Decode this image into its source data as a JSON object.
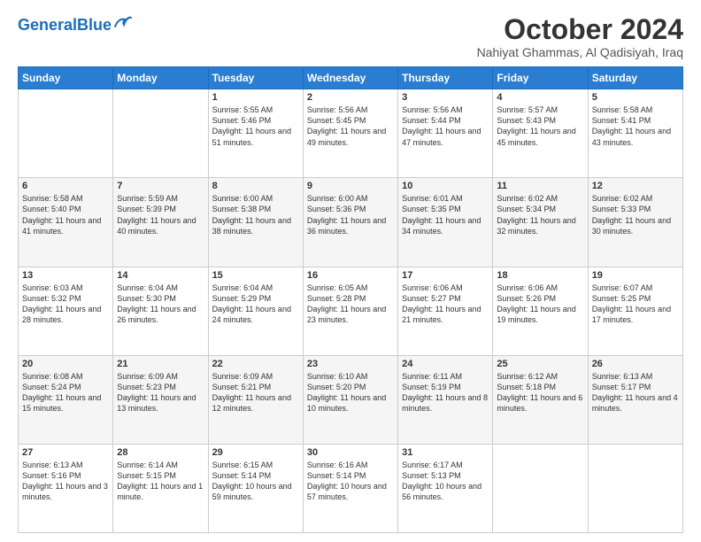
{
  "header": {
    "logo_general": "General",
    "logo_blue": "Blue",
    "month_title": "October 2024",
    "subtitle": "Nahiyat Ghammas, Al Qadisiyah, Iraq"
  },
  "days_of_week": [
    "Sunday",
    "Monday",
    "Tuesday",
    "Wednesday",
    "Thursday",
    "Friday",
    "Saturday"
  ],
  "weeks": [
    [
      {
        "day": "",
        "sunrise": "",
        "sunset": "",
        "daylight": ""
      },
      {
        "day": "",
        "sunrise": "",
        "sunset": "",
        "daylight": ""
      },
      {
        "day": "1",
        "sunrise": "Sunrise: 5:55 AM",
        "sunset": "Sunset: 5:46 PM",
        "daylight": "Daylight: 11 hours and 51 minutes."
      },
      {
        "day": "2",
        "sunrise": "Sunrise: 5:56 AM",
        "sunset": "Sunset: 5:45 PM",
        "daylight": "Daylight: 11 hours and 49 minutes."
      },
      {
        "day": "3",
        "sunrise": "Sunrise: 5:56 AM",
        "sunset": "Sunset: 5:44 PM",
        "daylight": "Daylight: 11 hours and 47 minutes."
      },
      {
        "day": "4",
        "sunrise": "Sunrise: 5:57 AM",
        "sunset": "Sunset: 5:43 PM",
        "daylight": "Daylight: 11 hours and 45 minutes."
      },
      {
        "day": "5",
        "sunrise": "Sunrise: 5:58 AM",
        "sunset": "Sunset: 5:41 PM",
        "daylight": "Daylight: 11 hours and 43 minutes."
      }
    ],
    [
      {
        "day": "6",
        "sunrise": "Sunrise: 5:58 AM",
        "sunset": "Sunset: 5:40 PM",
        "daylight": "Daylight: 11 hours and 41 minutes."
      },
      {
        "day": "7",
        "sunrise": "Sunrise: 5:59 AM",
        "sunset": "Sunset: 5:39 PM",
        "daylight": "Daylight: 11 hours and 40 minutes."
      },
      {
        "day": "8",
        "sunrise": "Sunrise: 6:00 AM",
        "sunset": "Sunset: 5:38 PM",
        "daylight": "Daylight: 11 hours and 38 minutes."
      },
      {
        "day": "9",
        "sunrise": "Sunrise: 6:00 AM",
        "sunset": "Sunset: 5:36 PM",
        "daylight": "Daylight: 11 hours and 36 minutes."
      },
      {
        "day": "10",
        "sunrise": "Sunrise: 6:01 AM",
        "sunset": "Sunset: 5:35 PM",
        "daylight": "Daylight: 11 hours and 34 minutes."
      },
      {
        "day": "11",
        "sunrise": "Sunrise: 6:02 AM",
        "sunset": "Sunset: 5:34 PM",
        "daylight": "Daylight: 11 hours and 32 minutes."
      },
      {
        "day": "12",
        "sunrise": "Sunrise: 6:02 AM",
        "sunset": "Sunset: 5:33 PM",
        "daylight": "Daylight: 11 hours and 30 minutes."
      }
    ],
    [
      {
        "day": "13",
        "sunrise": "Sunrise: 6:03 AM",
        "sunset": "Sunset: 5:32 PM",
        "daylight": "Daylight: 11 hours and 28 minutes."
      },
      {
        "day": "14",
        "sunrise": "Sunrise: 6:04 AM",
        "sunset": "Sunset: 5:30 PM",
        "daylight": "Daylight: 11 hours and 26 minutes."
      },
      {
        "day": "15",
        "sunrise": "Sunrise: 6:04 AM",
        "sunset": "Sunset: 5:29 PM",
        "daylight": "Daylight: 11 hours and 24 minutes."
      },
      {
        "day": "16",
        "sunrise": "Sunrise: 6:05 AM",
        "sunset": "Sunset: 5:28 PM",
        "daylight": "Daylight: 11 hours and 23 minutes."
      },
      {
        "day": "17",
        "sunrise": "Sunrise: 6:06 AM",
        "sunset": "Sunset: 5:27 PM",
        "daylight": "Daylight: 11 hours and 21 minutes."
      },
      {
        "day": "18",
        "sunrise": "Sunrise: 6:06 AM",
        "sunset": "Sunset: 5:26 PM",
        "daylight": "Daylight: 11 hours and 19 minutes."
      },
      {
        "day": "19",
        "sunrise": "Sunrise: 6:07 AM",
        "sunset": "Sunset: 5:25 PM",
        "daylight": "Daylight: 11 hours and 17 minutes."
      }
    ],
    [
      {
        "day": "20",
        "sunrise": "Sunrise: 6:08 AM",
        "sunset": "Sunset: 5:24 PM",
        "daylight": "Daylight: 11 hours and 15 minutes."
      },
      {
        "day": "21",
        "sunrise": "Sunrise: 6:09 AM",
        "sunset": "Sunset: 5:23 PM",
        "daylight": "Daylight: 11 hours and 13 minutes."
      },
      {
        "day": "22",
        "sunrise": "Sunrise: 6:09 AM",
        "sunset": "Sunset: 5:21 PM",
        "daylight": "Daylight: 11 hours and 12 minutes."
      },
      {
        "day": "23",
        "sunrise": "Sunrise: 6:10 AM",
        "sunset": "Sunset: 5:20 PM",
        "daylight": "Daylight: 11 hours and 10 minutes."
      },
      {
        "day": "24",
        "sunrise": "Sunrise: 6:11 AM",
        "sunset": "Sunset: 5:19 PM",
        "daylight": "Daylight: 11 hours and 8 minutes."
      },
      {
        "day": "25",
        "sunrise": "Sunrise: 6:12 AM",
        "sunset": "Sunset: 5:18 PM",
        "daylight": "Daylight: 11 hours and 6 minutes."
      },
      {
        "day": "26",
        "sunrise": "Sunrise: 6:13 AM",
        "sunset": "Sunset: 5:17 PM",
        "daylight": "Daylight: 11 hours and 4 minutes."
      }
    ],
    [
      {
        "day": "27",
        "sunrise": "Sunrise: 6:13 AM",
        "sunset": "Sunset: 5:16 PM",
        "daylight": "Daylight: 11 hours and 3 minutes."
      },
      {
        "day": "28",
        "sunrise": "Sunrise: 6:14 AM",
        "sunset": "Sunset: 5:15 PM",
        "daylight": "Daylight: 11 hours and 1 minute."
      },
      {
        "day": "29",
        "sunrise": "Sunrise: 6:15 AM",
        "sunset": "Sunset: 5:14 PM",
        "daylight": "Daylight: 10 hours and 59 minutes."
      },
      {
        "day": "30",
        "sunrise": "Sunrise: 6:16 AM",
        "sunset": "Sunset: 5:14 PM",
        "daylight": "Daylight: 10 hours and 57 minutes."
      },
      {
        "day": "31",
        "sunrise": "Sunrise: 6:17 AM",
        "sunset": "Sunset: 5:13 PM",
        "daylight": "Daylight: 10 hours and 56 minutes."
      },
      {
        "day": "",
        "sunrise": "",
        "sunset": "",
        "daylight": ""
      },
      {
        "day": "",
        "sunrise": "",
        "sunset": "",
        "daylight": ""
      }
    ]
  ]
}
